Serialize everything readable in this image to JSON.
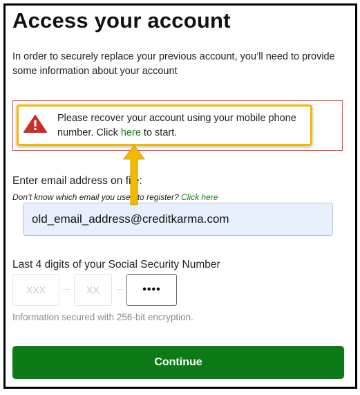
{
  "page": {
    "title": "Access your account",
    "intro": "In order to securely replace your previous account, you’ll need to provide some information about your account"
  },
  "alert": {
    "text_before": "Please recover your account using your mobile phone number. Click ",
    "link_text": "here",
    "text_after": " to start.",
    "icon": "warning-triangle-icon",
    "border_color": "#d9534f",
    "highlight_color": "#f5b800"
  },
  "email": {
    "label": "Enter email address on file:",
    "help_text": "Don’t know which email you used to register? ",
    "help_link": "Click here",
    "value": "old_email_address@creditkarma.com"
  },
  "ssn": {
    "label": "Last 4 digits of your Social Security Number",
    "part1_placeholder": "XXX",
    "part2_placeholder": "XX",
    "part3_value": "••••",
    "secure_note": "Information secured with 256-bit encryption."
  },
  "actions": {
    "continue_label": "Continue",
    "continue_color": "#0c7a17"
  },
  "annotation": {
    "arrow": "up-arrow-icon",
    "arrow_color": "#f5b800"
  }
}
